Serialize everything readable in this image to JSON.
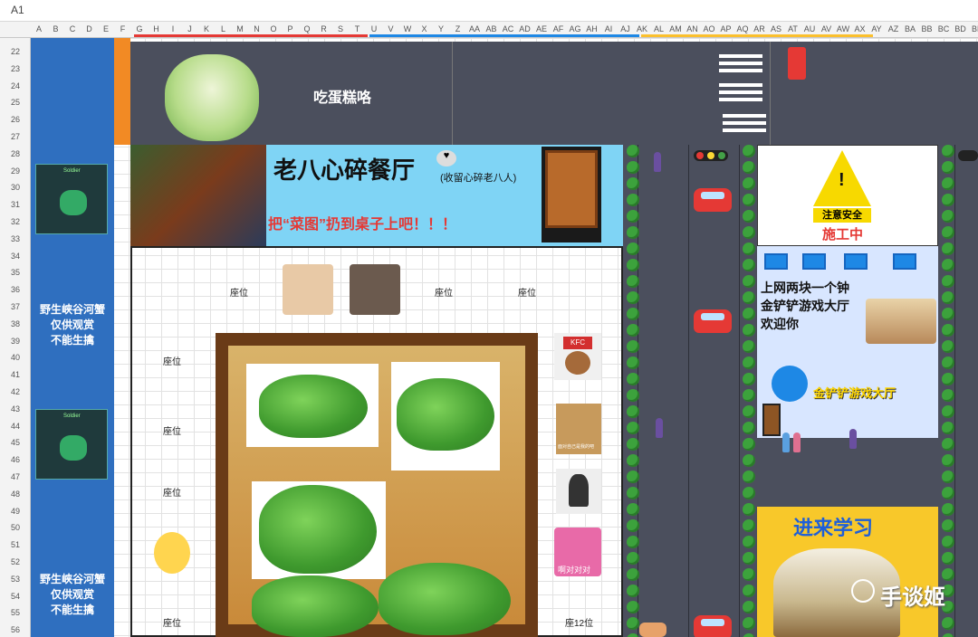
{
  "namebox": {
    "cell": "A1"
  },
  "columns": [
    "A",
    "B",
    "C",
    "D",
    "E",
    "F",
    "G",
    "H",
    "I",
    "J",
    "K",
    "L",
    "M",
    "N",
    "O",
    "P",
    "Q",
    "R",
    "S",
    "T",
    "U",
    "V",
    "W",
    "X",
    "Y",
    "Z",
    "AA",
    "AB",
    "AC",
    "AD",
    "AE",
    "AF",
    "AG",
    "AH",
    "AI",
    "AJ",
    "AK",
    "AL",
    "AM",
    "AN",
    "AO",
    "AP",
    "AQ",
    "AR",
    "AS",
    "AT",
    "AU",
    "AV",
    "AW",
    "AX",
    "AY",
    "AZ",
    "BA",
    "BB",
    "BC",
    "BD",
    "BE"
  ],
  "rows": [
    "22",
    "23",
    "24",
    "25",
    "26",
    "27",
    "28",
    "29",
    "30",
    "31",
    "32",
    "33",
    "34",
    "35",
    "36",
    "37",
    "38",
    "39",
    "40",
    "41",
    "42",
    "43",
    "44",
    "45",
    "46",
    "47",
    "48",
    "49",
    "50",
    "51",
    "52",
    "53",
    "54",
    "55",
    "56"
  ],
  "banner": {
    "title": "吃蛋糕咯"
  },
  "restaurant": {
    "name": "老八心碎餐厅",
    "sub": "(收留心碎老八人)",
    "slogan": "把“菜图”扔到桌子上吧！！！"
  },
  "left_notice_1": [
    "野生峡谷河蟹",
    "仅供观赏",
    "不能生擒"
  ],
  "left_notice_2": [
    "野生峡谷河蟹",
    "仅供观赏",
    "不能生擒"
  ],
  "thumb_label": "Soldier",
  "seats": {
    "top_1": "座位",
    "top_2": "座位",
    "top_3": "座位",
    "left_1": "座位",
    "left_2": "座位",
    "left_3": "座位",
    "left_4": "座位",
    "right_last": "座12位"
  },
  "side_labels": {
    "kfc": "KFC",
    "duiduidui": "啊对对对",
    "photo_caption": "面对自己是我的吧"
  },
  "warning": {
    "line1": "注意安全",
    "line2": "施工中"
  },
  "internet_cafe": {
    "line1": "上网两块一个钟",
    "line2": "金铲铲游戏大厅",
    "line3": "欢迎你",
    "logo": "金铲铲游戏大厅"
  },
  "study": {
    "title": "进来学习"
  },
  "watermark": "手谈姬",
  "colors": {
    "sidebar_blue": "#2f6fbf",
    "road": "#4b4f5d",
    "banner_light_blue": "#7fd4f5",
    "warning_yellow": "#f7d900",
    "study_yellow": "#f8c82a"
  }
}
